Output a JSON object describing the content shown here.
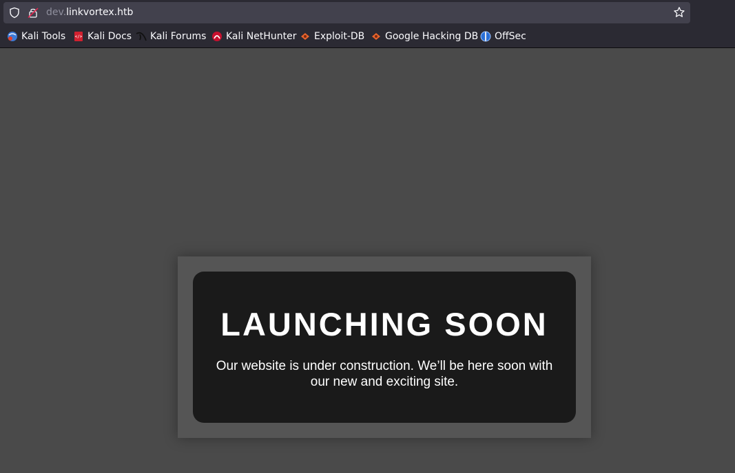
{
  "browser": {
    "url_subdomain": "dev.",
    "url_domain": "linkvortex.htb",
    "bookmarks": [
      {
        "label": "Kali Tools",
        "icon": "kali-tools-icon"
      },
      {
        "label": "Kali Docs",
        "icon": "kali-docs-icon"
      },
      {
        "label": "Kali Forums",
        "icon": "kali-forums-icon"
      },
      {
        "label": "Kali NetHunter",
        "icon": "kali-nethunter-icon"
      },
      {
        "label": "Exploit-DB",
        "icon": "exploit-db-icon"
      },
      {
        "label": "Google Hacking DB",
        "icon": "google-hacking-db-icon"
      },
      {
        "label": "OffSec",
        "icon": "offsec-icon"
      }
    ]
  },
  "page": {
    "headline": "LAUNCHING SOON",
    "message": "Our website is under construction. We’ll be here soon with our new and exciting site."
  },
  "colors": {
    "page_background": "#4a4a4a",
    "panel": "#555555",
    "card": "#1a1a1a",
    "text": "#ffffff"
  }
}
